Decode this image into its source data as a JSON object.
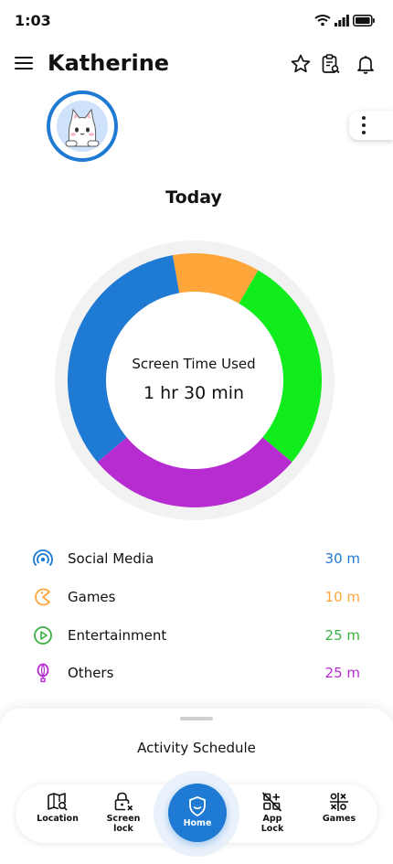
{
  "status_bar": {
    "time": "1:03"
  },
  "header": {
    "title": "Katherine"
  },
  "today_label": "Today",
  "summary": {
    "label": "Screen Time Used",
    "value": "1 hr 30 min"
  },
  "chart_data": {
    "type": "pie",
    "categories": [
      "Social Media",
      "Games",
      "Entertainment",
      "Others"
    ],
    "values": [
      30,
      10,
      25,
      25
    ],
    "colors": [
      "#1e7ad3",
      "#ffa63b",
      "#10ec1c",
      "#b62cd0"
    ]
  },
  "legend": [
    {
      "name": "Social Media",
      "value": "30 m",
      "color": "#1e7ad3",
      "icon": "radar-icon"
    },
    {
      "name": "Games",
      "value": "10 m",
      "color": "#ffa63b",
      "icon": "pacman-icon"
    },
    {
      "name": "Entertainment",
      "value": "25 m",
      "color": "#3cb043",
      "icon": "play-icon"
    },
    {
      "name": "Others",
      "value": "25 m",
      "color": "#b62cd0",
      "icon": "balloon-icon"
    }
  ],
  "sheet": {
    "title": "Activity Schedule"
  },
  "nav": {
    "location": "Location",
    "screen_lock": [
      "Screen",
      "lock"
    ],
    "home": "Home",
    "app_lock": [
      "App",
      "Lock"
    ],
    "games": "Games"
  },
  "colors": {
    "accent": "#1e7ad3",
    "ring_track": "#f2f2f2"
  }
}
